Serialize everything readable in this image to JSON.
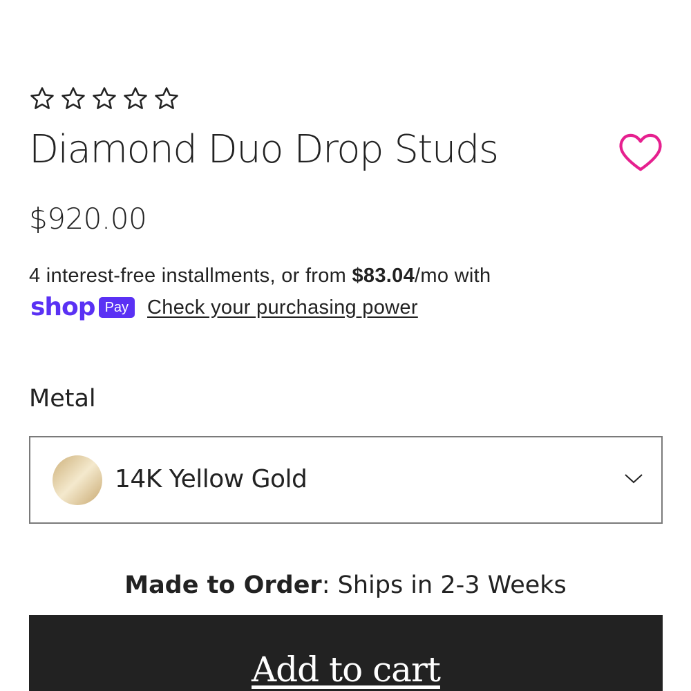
{
  "rating": {
    "filled": 0,
    "max": 5,
    "icon": "star-outline-icon"
  },
  "product": {
    "title": "Diamond Duo Drop Studs",
    "price": "$920.00"
  },
  "wishlist": {
    "icon": "heart-outline-icon",
    "color": "#e6208f"
  },
  "financing": {
    "text_before": "4 interest-free installments, or from ",
    "amount": "$83.04",
    "text_after": "/mo with",
    "brand_shop": "shop",
    "brand_pay": "Pay",
    "brand_color": "#5a31f4",
    "link_label": "Check your purchasing power"
  },
  "metal": {
    "label": "Metal",
    "selected": "14K Yellow Gold",
    "swatch_icon": "gold-swatch",
    "dropdown_icon": "chevron-down-icon"
  },
  "shipping": {
    "label": "Made to Order",
    "separator": ":",
    "detail": " Ships in 2-3 Weeks"
  },
  "cart": {
    "button_label": "Add to cart",
    "background": "#222222"
  }
}
